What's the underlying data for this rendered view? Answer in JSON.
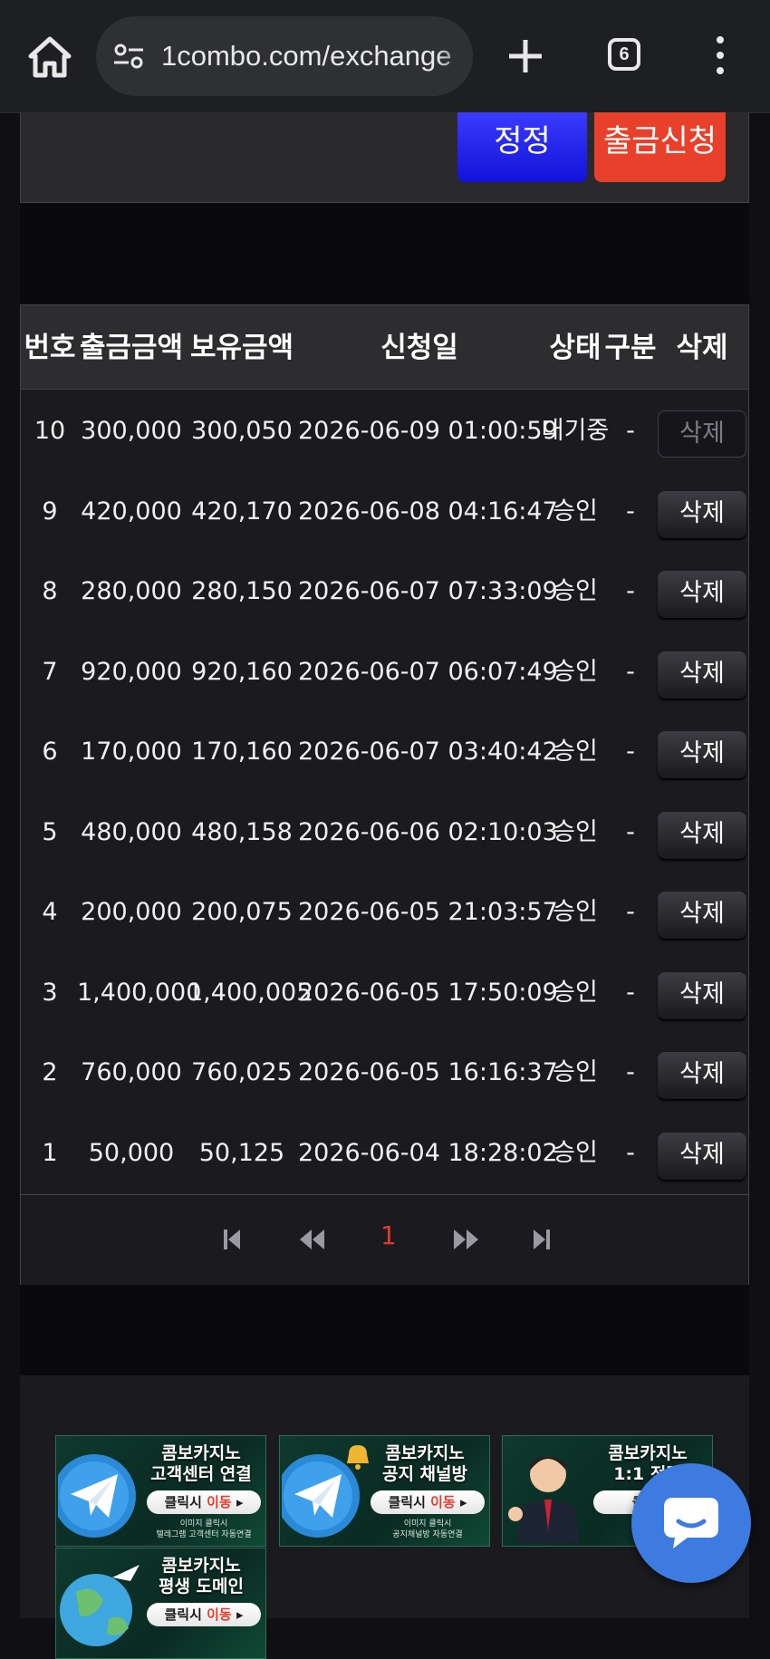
{
  "browser": {
    "url": "1combo.com/exchange",
    "tab_count": "6"
  },
  "actions": {
    "correct_label": "정정",
    "withdraw_request_label": "출금신청"
  },
  "table": {
    "headers": {
      "no": "번호",
      "withdraw_amount": "출금금액",
      "holding_amount": "보유금액",
      "request_date": "신청일",
      "status": "상태",
      "category": "구분",
      "delete": "삭제"
    },
    "rows": [
      {
        "no": "10",
        "amount": "300,000",
        "balance": "300,050",
        "date": "2026-06-09 01:00:59",
        "status": "대기중",
        "category": "-",
        "delete": "삭제",
        "delete_disabled": true
      },
      {
        "no": "9",
        "amount": "420,000",
        "balance": "420,170",
        "date": "2026-06-08 04:16:47",
        "status": "승인",
        "category": "-",
        "delete": "삭제",
        "delete_disabled": false
      },
      {
        "no": "8",
        "amount": "280,000",
        "balance": "280,150",
        "date": "2026-06-07 07:33:09",
        "status": "승인",
        "category": "-",
        "delete": "삭제",
        "delete_disabled": false
      },
      {
        "no": "7",
        "amount": "920,000",
        "balance": "920,160",
        "date": "2026-06-07 06:07:49",
        "status": "승인",
        "category": "-",
        "delete": "삭제",
        "delete_disabled": false
      },
      {
        "no": "6",
        "amount": "170,000",
        "balance": "170,160",
        "date": "2026-06-07 03:40:42",
        "status": "승인",
        "category": "-",
        "delete": "삭제",
        "delete_disabled": false
      },
      {
        "no": "5",
        "amount": "480,000",
        "balance": "480,158",
        "date": "2026-06-06 02:10:03",
        "status": "승인",
        "category": "-",
        "delete": "삭제",
        "delete_disabled": false
      },
      {
        "no": "4",
        "amount": "200,000",
        "balance": "200,075",
        "date": "2026-06-05 21:03:57",
        "status": "승인",
        "category": "-",
        "delete": "삭제",
        "delete_disabled": false
      },
      {
        "no": "3",
        "amount": "1,400,000",
        "balance": "1,400,005",
        "date": "2026-06-05 17:50:09",
        "status": "승인",
        "category": "-",
        "delete": "삭제",
        "delete_disabled": false
      },
      {
        "no": "2",
        "amount": "760,000",
        "balance": "760,025",
        "date": "2026-06-05 16:16:37",
        "status": "승인",
        "category": "-",
        "delete": "삭제",
        "delete_disabled": false
      },
      {
        "no": "1",
        "amount": "50,000",
        "balance": "50,125",
        "date": "2026-06-04 18:28:02",
        "status": "승인",
        "category": "-",
        "delete": "삭제",
        "delete_disabled": false
      }
    ]
  },
  "pagination": {
    "current_page": "1",
    "active_color": "#e23a2a"
  },
  "banners": [
    {
      "title1": "콤보카지노",
      "title2": "고객센터 연결",
      "pill_prefix": "클릭시 ",
      "pill_action": "이동",
      "small1": "이미지 클릭시",
      "small2": "텔레그램 고객센터 자동연결",
      "icon": "telegram-icon"
    },
    {
      "title1": "콤보카지노",
      "title2": "공지 채널방",
      "pill_prefix": "클릭시 ",
      "pill_action": "이동",
      "small1": "이미지 클릭시",
      "small2": "공지채널방 자동연결",
      "icon": "telegram-bell-icon"
    },
    {
      "title1": "콤보카지노",
      "title2": "1:1 전담",
      "pill_prefix": "클릭",
      "pill_action": "",
      "small1": "이",
      "small2": "전담",
      "icon": "agent-avatar"
    },
    {
      "title1": "콤보카지노",
      "title2": "평생 도메인",
      "pill_prefix": "클릭시 ",
      "pill_action": "이동",
      "small1": "",
      "small2": "",
      "icon": "globe-icon"
    }
  ],
  "colors": {
    "correct_button": "#1212d8",
    "withdraw_button": "#e8402a",
    "chat_button": "#3d7be0"
  }
}
